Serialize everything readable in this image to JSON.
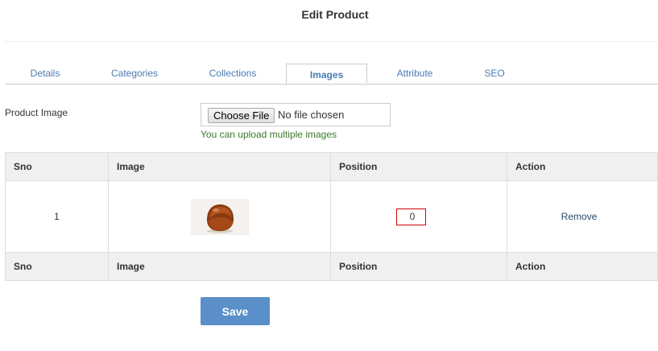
{
  "page": {
    "title": "Edit Product"
  },
  "tabs": [
    {
      "label": "Details"
    },
    {
      "label": "Categories"
    },
    {
      "label": "Collections"
    },
    {
      "label": "Images",
      "active": true
    },
    {
      "label": "Attribute"
    },
    {
      "label": "SEO"
    }
  ],
  "form": {
    "product_image_label": "Product Image",
    "choose_file_label": "Choose File",
    "file_status": "No file chosen",
    "hint": "You can upload multiple images"
  },
  "table": {
    "headers": [
      "Sno",
      "Image",
      "Position",
      "Action"
    ],
    "rows": [
      {
        "sno": "1",
        "position": "0",
        "action": "Remove"
      }
    ],
    "footers": [
      "Sno",
      "Image",
      "Position",
      "Action"
    ]
  },
  "actions": {
    "save_label": "Save"
  }
}
